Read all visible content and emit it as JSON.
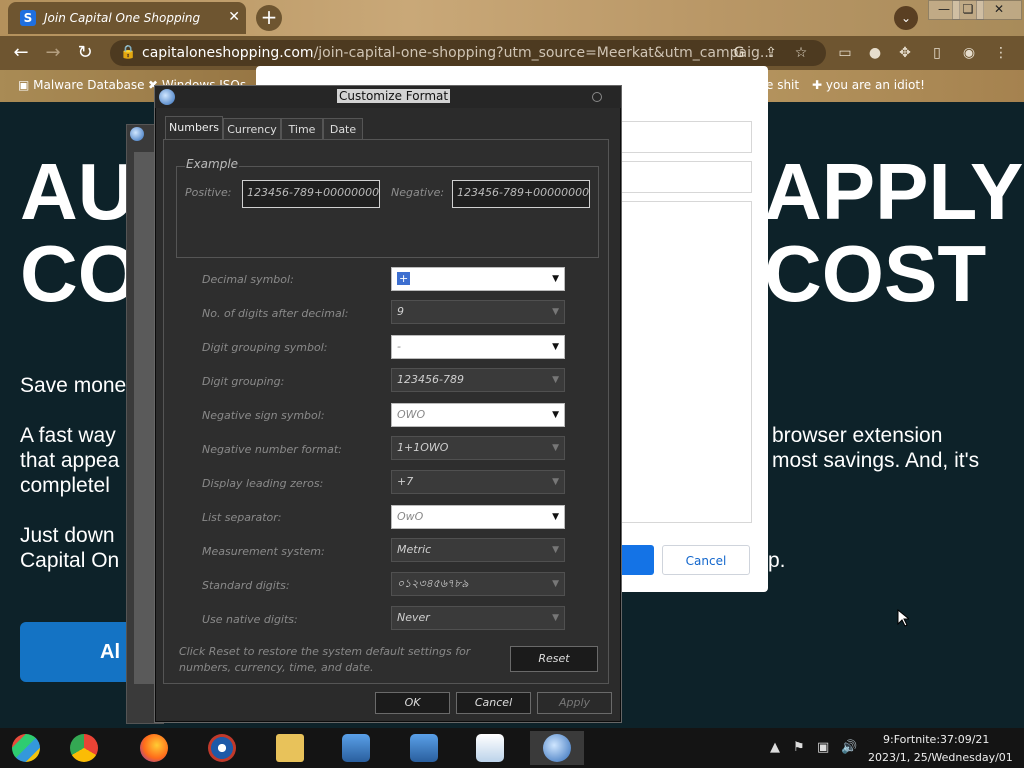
{
  "browser": {
    "tab_title": "Join Capital One Shopping",
    "tab_icon_letter": "S",
    "new_tab": "+",
    "window_buttons": {
      "minimize": "—",
      "maximize": "❏",
      "close": "✕"
    },
    "url_domain": "capitaloneshopping.com",
    "url_rest": "/join-capital-one-shopping?utm_source=Meerkat&utm_campaig...",
    "bookmarks": [
      "Malware Database",
      "Windows ISOs",
      "e shit",
      "you are an idiot!"
    ]
  },
  "page": {
    "hero_left_1": "AU",
    "hero_left_2": "CO",
    "hero_right_1": "APPLY",
    "hero_right_2": "COST",
    "line_save": "Save mone",
    "line_fast": "A fast way",
    "line_appear": "that appea",
    "line_complete": "completel",
    "right_browser": "browser extension",
    "right_savings": "most savings. And, it's",
    "line_download": "Just down",
    "line_capital": "Capital On",
    "right_p": "p.",
    "cta": "Al",
    "modal_cancel": "Cancel"
  },
  "dialog": {
    "title": "Customize Format",
    "tabs": [
      "Numbers",
      "Currency",
      "Time",
      "Date"
    ],
    "active_tab": "Numbers",
    "example_label": "Example",
    "positive_label": "Positive:",
    "positive_value": "123456-789+000000000",
    "negative_label": "Negative:",
    "negative_value": "123456-789+000000000",
    "rows": [
      {
        "label": "Decimal symbol:",
        "value": "+",
        "style": "light",
        "selected": true
      },
      {
        "label": "No. of digits after decimal:",
        "value": "9",
        "style": "dark"
      },
      {
        "label": "Digit grouping symbol:",
        "value": "-",
        "style": "light"
      },
      {
        "label": "Digit grouping:",
        "value": "123456-789",
        "style": "dark"
      },
      {
        "label": "Negative sign symbol:",
        "value": "OWO",
        "style": "light"
      },
      {
        "label": "Negative number format:",
        "value": "1+1OWO",
        "style": "dark"
      },
      {
        "label": "Display leading zeros:",
        "value": "+7",
        "style": "dark"
      },
      {
        "label": "List separator:",
        "value": "OwO",
        "style": "light"
      },
      {
        "label": "Measurement system:",
        "value": "Metric",
        "style": "dark"
      },
      {
        "label": "Standard digits:",
        "value": "০১২৩৪৫৬৭৮৯",
        "style": "dark"
      },
      {
        "label": "Use native digits:",
        "value": "Never",
        "style": "dark"
      }
    ],
    "reset_note": "Click Reset to restore the system default settings for numbers, currency, time, and date.",
    "reset_button": "Reset",
    "ok_button": "OK",
    "cancel_button": "Cancel",
    "apply_button": "Apply"
  },
  "taskbar": {
    "clock_line1": "9:Fortnite:37:09/21",
    "clock_line2": "2023/1, 25/Wednesday/01"
  },
  "colors": {
    "accent": "#1473c4",
    "page_bg": "#0d2229",
    "dialog_bg": "#2b2b2b"
  }
}
